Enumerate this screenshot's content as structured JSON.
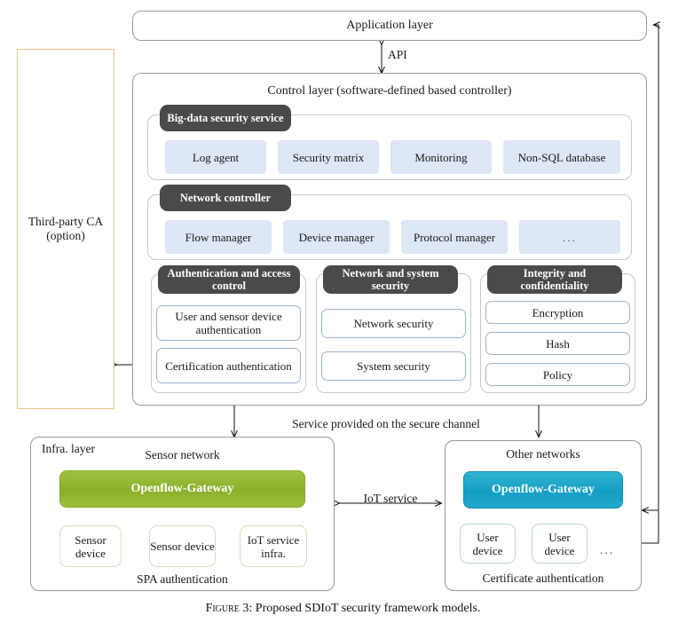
{
  "figure": {
    "label": "Figure 3:",
    "caption": "Proposed SDIoT security framework models."
  },
  "colors": {
    "tag_bg": "#4a4a4a",
    "chip_bg": "#dde7f5",
    "gateway_green": "#8cb02c",
    "gateway_teal": "#159ec2",
    "ca_border": "#edc08a",
    "outer_border": "#9a9a9a"
  },
  "application_layer": {
    "title": "Application layer"
  },
  "api_connector": {
    "label": "API"
  },
  "third_party_ca": {
    "line1": "Third-party CA",
    "line2": "(option)"
  },
  "control_layer": {
    "title": "Control layer (software-defined based controller)",
    "panels": [
      {
        "tag": "Big-data security service",
        "items": [
          "Log agent",
          "Security matrix",
          "Monitoring",
          "Non-SQL database"
        ]
      },
      {
        "tag": "Network controller",
        "items": [
          "Flow manager",
          "Device manager",
          "Protocol manager",
          "..."
        ]
      }
    ],
    "security_modules": [
      {
        "tag": "Authentication and access control",
        "items": [
          "User and sensor device authentication",
          "Certification authentication"
        ]
      },
      {
        "tag": "Network and system security",
        "items": [
          "Network security",
          "System security"
        ]
      },
      {
        "tag": "Integrity and confidentiality",
        "items": [
          "Encryption",
          "Hash",
          "Policy"
        ]
      }
    ]
  },
  "secure_channel": {
    "label": "Service provided on the secure channel"
  },
  "iot_service": {
    "label": "IoT service"
  },
  "infra_layer": {
    "title": "Infra. layer",
    "sensor_network": {
      "title": "Sensor network",
      "gateway": "Openflow-Gateway",
      "devices": [
        "Sensor device",
        "Sensor device",
        "IoT service infra."
      ],
      "footer": "SPA authentication"
    },
    "other_networks": {
      "title": "Other networks",
      "gateway": "Openflow-Gateway",
      "devices": [
        "User device",
        "User device"
      ],
      "ellipsis": "...",
      "footer": "Certificate authentication"
    }
  }
}
